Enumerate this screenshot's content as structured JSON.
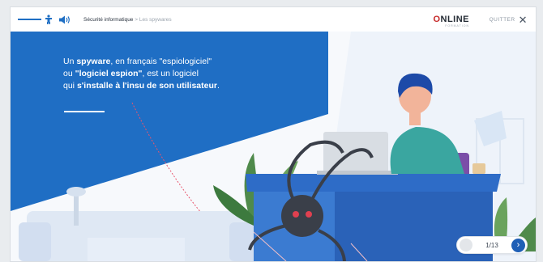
{
  "header": {
    "breadcrumb_section": "Sécurité informatique",
    "breadcrumb_separator": ">",
    "breadcrumb_current": "Les spywares",
    "brand_name": "NLINE",
    "brand_initial": "O",
    "brand_tagline": "FORMATION",
    "quit_label": "QUITTER"
  },
  "slide": {
    "intro_text_parts": {
      "p1": "Un ",
      "p2": "spyware",
      "p3": ", en français \"espiologiciel\"",
      "p4": "ou ",
      "p5": "\"logiciel espion\"",
      "p6": ", est un logiciel",
      "p7": "qui ",
      "p8": "s'installe à l'insu de son utilisateur",
      "p9": "."
    }
  },
  "pager": {
    "counter": "1/13",
    "next_glyph": "›"
  },
  "icons": [
    "menu-icon",
    "accessibility-icon",
    "volume-icon",
    "close-icon",
    "chevron-right-icon"
  ],
  "colors": {
    "primary_blue": "#1f6fc4",
    "text_dark": "#232a33",
    "brand_red": "#c62828",
    "pager_blue": "#1f5fb6"
  }
}
